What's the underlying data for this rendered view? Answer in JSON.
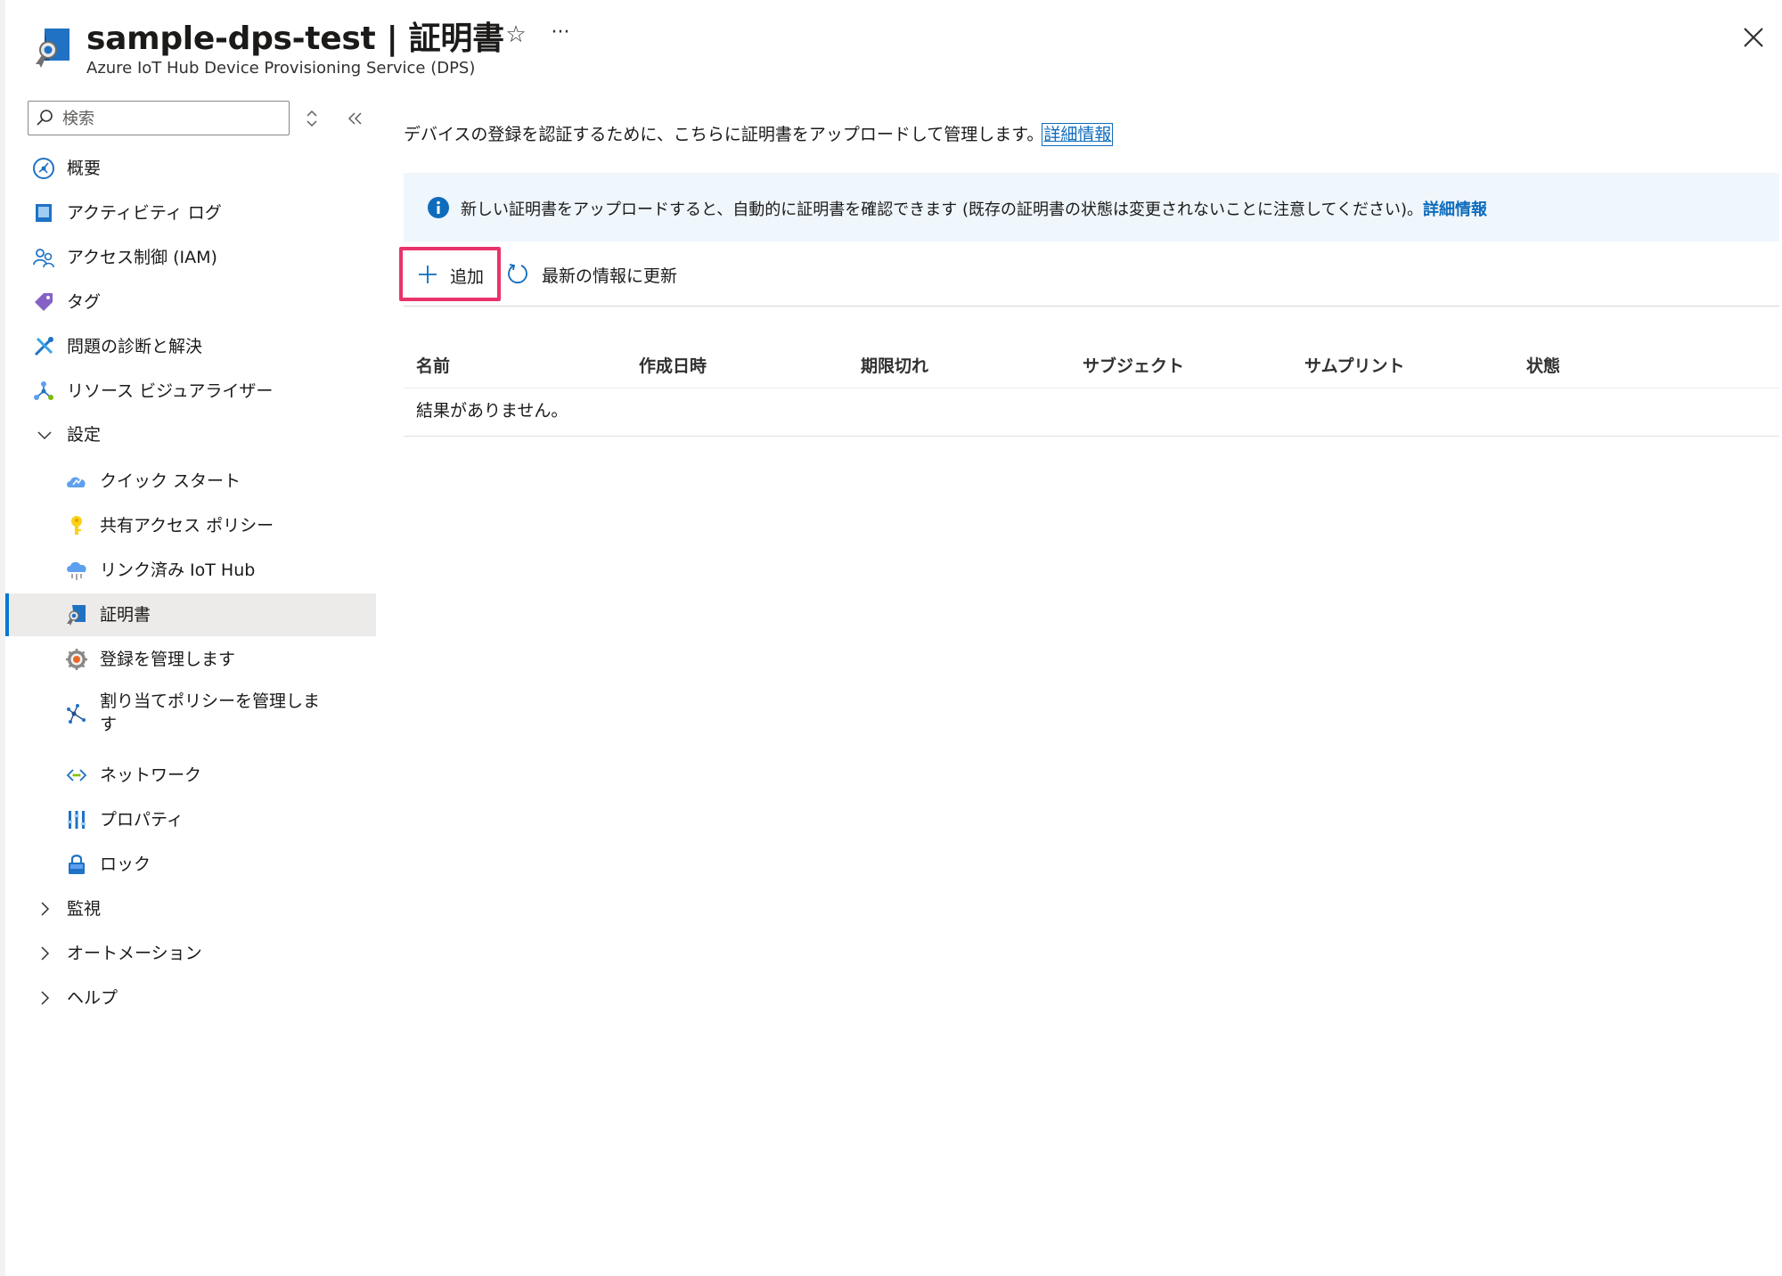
{
  "header": {
    "title": "sample-dps-test | 証明書",
    "subtitle": "Azure IoT Hub Device Provisioning Service (DPS)",
    "favorite_icon": "star-icon",
    "more_icon": "ellipsis-icon",
    "close_icon": "close-icon"
  },
  "sidebar": {
    "search": {
      "placeholder": "検索",
      "value": ""
    },
    "items": [
      {
        "label": "概要",
        "icon": "overview-icon"
      },
      {
        "label": "アクティビティ ログ",
        "icon": "activity-log-icon"
      },
      {
        "label": "アクセス制御 (IAM)",
        "icon": "iam-icon"
      },
      {
        "label": "タグ",
        "icon": "tag-icon"
      },
      {
        "label": "問題の診断と解決",
        "icon": "diagnose-icon"
      },
      {
        "label": "リソース ビジュアライザー",
        "icon": "visualizer-icon"
      },
      {
        "label": "設定",
        "icon": "chevron-down-icon",
        "expanded": true
      },
      {
        "label": "クイック スタート",
        "icon": "quickstart-icon"
      },
      {
        "label": "共有アクセス ポリシー",
        "icon": "key-icon"
      },
      {
        "label": "リンク済み IoT Hub",
        "icon": "iot-hub-icon"
      },
      {
        "label": "証明書",
        "icon": "certificate-icon",
        "active": true
      },
      {
        "label": "登録を管理します",
        "icon": "enrollment-gear-icon"
      },
      {
        "label": "割り当てポリシーを管理します",
        "icon": "allocation-policy-icon"
      },
      {
        "label": "ネットワーク",
        "icon": "network-icon"
      },
      {
        "label": "プロパティ",
        "icon": "properties-icon"
      },
      {
        "label": "ロック",
        "icon": "lock-icon"
      },
      {
        "label": "監視",
        "icon": "chevron-right-icon",
        "expanded": false
      },
      {
        "label": "オートメーション",
        "icon": "chevron-right-icon",
        "expanded": false
      },
      {
        "label": "ヘルプ",
        "icon": "chevron-right-icon",
        "expanded": false
      }
    ]
  },
  "main": {
    "description": "デバイスの登録を認証するために、こちらに証明書をアップロードして管理します。",
    "description_link": "詳細情報",
    "info": {
      "text": "新しい証明書をアップロードすると、自動的に証明書を確認できます (既存の証明書の状態は変更されないことに注意してください)。",
      "link": "詳細情報"
    },
    "toolbar": {
      "add_label": "追加",
      "refresh_label": "最新の情報に更新"
    },
    "table": {
      "columns": [
        "名前",
        "作成日時",
        "期限切れ",
        "サブジェクト",
        "サムプリント",
        "状態"
      ],
      "empty_message": "結果がありません。"
    }
  },
  "colors": {
    "accent": "#0078d4",
    "link": "#0f6cbd",
    "info_bg": "#eff6fc",
    "highlight_border": "#e8336b",
    "active_bg": "#edebe9"
  }
}
